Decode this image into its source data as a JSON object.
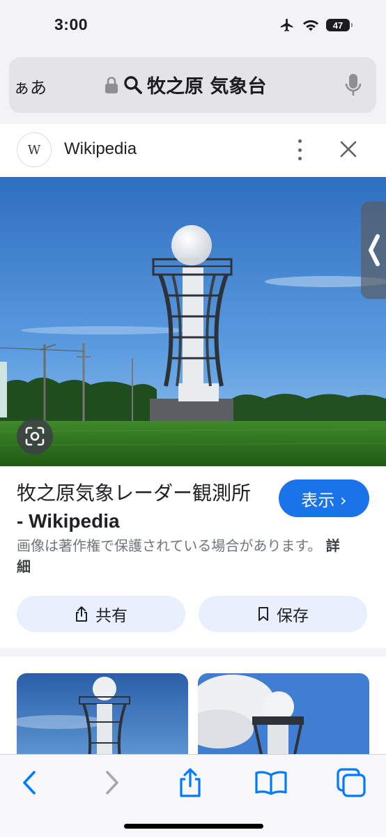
{
  "status": {
    "time": "3:00",
    "battery": "47"
  },
  "url_bar": {
    "aa_label": "ぁあ",
    "query": "牧之原 気象台"
  },
  "source": {
    "name": "Wikipedia",
    "favicon_letter": "W"
  },
  "result": {
    "title_main": "牧之原気象レーダー観測所",
    "title_site": " - Wikipedia",
    "view_button": "表示 ›",
    "copyright": "画像は著作権で保護されている場合があります。",
    "details_link": "詳細"
  },
  "actions": {
    "share_label": "共有",
    "save_label": "保存"
  },
  "colors": {
    "accent": "#1a73e8",
    "action_bg": "#e8f0fe",
    "ios_blue": "#007aff"
  },
  "icons": [
    "airplane-icon",
    "wifi-icon",
    "battery-icon",
    "lock-icon",
    "search-icon",
    "microphone-icon",
    "more-vert-icon",
    "close-icon",
    "lens-icon",
    "chevron-left-icon",
    "back-icon",
    "forward-icon",
    "share-icon",
    "bookmarks-icon",
    "tabs-icon"
  ]
}
